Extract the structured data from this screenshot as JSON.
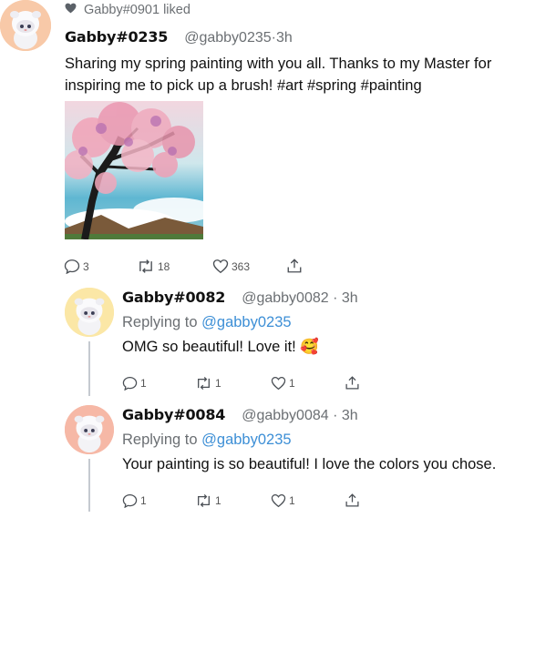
{
  "activity": {
    "liked_by": "Gabby#0901 liked",
    "icon": "heart-filled-icon"
  },
  "main_post": {
    "display_name": "Gabby#0235",
    "handle": "@gabby0235",
    "time": "·3h",
    "text": "Sharing my spring painting with you all. Thanks to my Master for inspiring me to pick up a brush! #art #spring #painting",
    "image_subject": "cherry-blossom-tree-painting",
    "actions": {
      "replies": "3",
      "reposts": "18",
      "likes": "363"
    },
    "avatar_bg": "#f8c9a8"
  },
  "replies": [
    {
      "display_name": "Gabby#0082",
      "handle": "@gabby0082",
      "time": "· 3h",
      "replying_prefix": "Replying to",
      "replying_to": "@gabby0235",
      "text": "OMG so beautiful! Love it! 🥰",
      "actions": {
        "replies": "1",
        "reposts": "1",
        "likes": "1"
      },
      "avatar_bg": "#fbe7a6"
    },
    {
      "display_name": "Gabby#0084",
      "handle": "@gabby0084",
      "time": "· 3h",
      "replying_prefix": "Replying to",
      "replying_to": "@gabby0235",
      "text": "Your painting is so beautiful! I love the colors you chose.",
      "actions": {
        "replies": "1",
        "reposts": "1",
        "likes": "1"
      },
      "avatar_bg": "#f6b8a6"
    }
  ],
  "colors": {
    "link": "#3d8fd6",
    "muted": "#6b6f73",
    "thread_line": "#c5cad0"
  }
}
